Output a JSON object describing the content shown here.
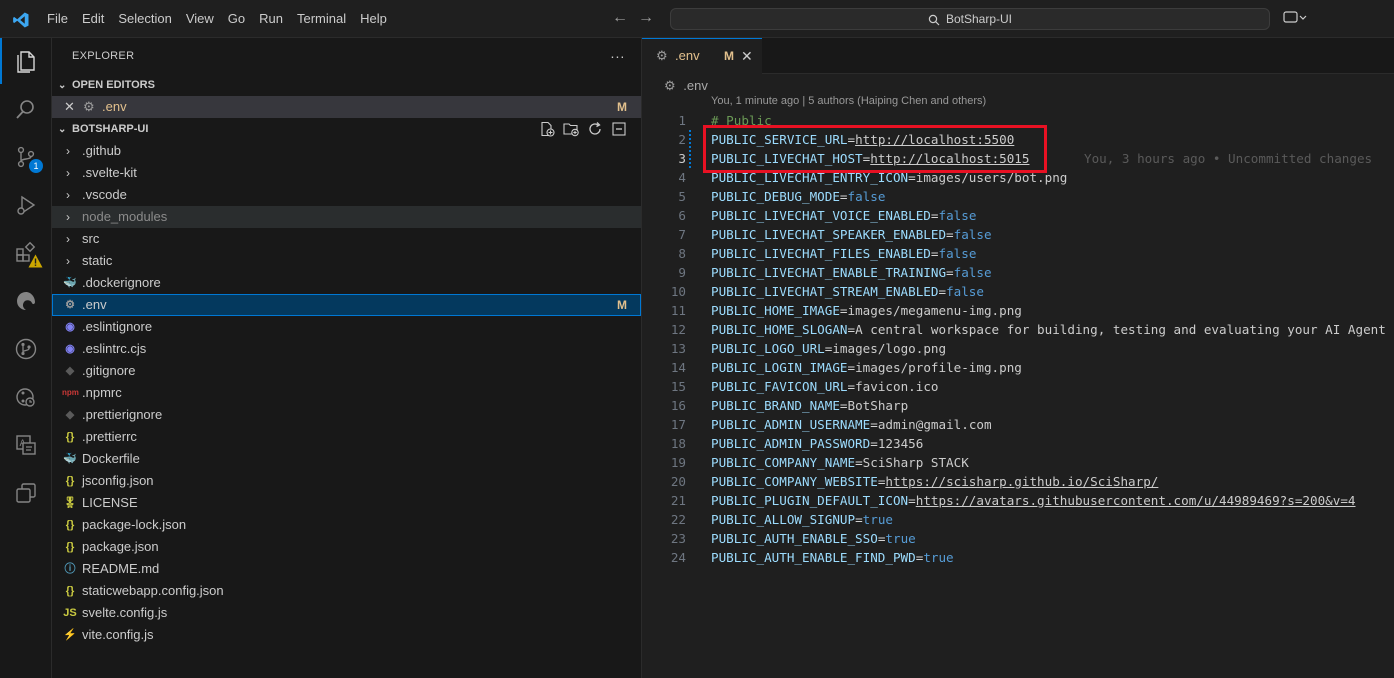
{
  "titlebar": {
    "menu": [
      "File",
      "Edit",
      "Selection",
      "View",
      "Go",
      "Run",
      "Terminal",
      "Help"
    ],
    "search_text": "BotSharp-UI"
  },
  "activity_bar": {
    "source_control_badge": "1"
  },
  "explorer": {
    "title": "EXPLORER",
    "more": "···",
    "open_editors": {
      "label": "OPEN EDITORS",
      "items": [
        {
          "name": ".env",
          "status": "M"
        }
      ]
    },
    "project": {
      "label": "BOTSHARP-UI",
      "items": [
        {
          "name": ".github",
          "type": "folder"
        },
        {
          "name": ".svelte-kit",
          "type": "folder"
        },
        {
          "name": ".vscode",
          "type": "folder"
        },
        {
          "name": "node_modules",
          "type": "folder"
        },
        {
          "name": "src",
          "type": "folder"
        },
        {
          "name": "static",
          "type": "folder"
        },
        {
          "name": ".dockerignore",
          "type": "file",
          "icon": "docker-icon"
        },
        {
          "name": ".env",
          "type": "file",
          "icon": "gear-icon",
          "status": "M"
        },
        {
          "name": ".eslintignore",
          "type": "file",
          "icon": "eslint-icon"
        },
        {
          "name": ".eslintrc.cjs",
          "type": "file",
          "icon": "eslint-icon"
        },
        {
          "name": ".gitignore",
          "type": "file",
          "icon": "git-icon"
        },
        {
          "name": ".npmrc",
          "type": "file",
          "icon": "npm-icon"
        },
        {
          "name": ".prettierignore",
          "type": "file",
          "icon": "prettier-icon"
        },
        {
          "name": ".prettierrc",
          "type": "file",
          "icon": "json-icon"
        },
        {
          "name": "Dockerfile",
          "type": "file",
          "icon": "docker-icon"
        },
        {
          "name": "jsconfig.json",
          "type": "file",
          "icon": "json-icon"
        },
        {
          "name": "LICENSE",
          "type": "file",
          "icon": "license-icon"
        },
        {
          "name": "package-lock.json",
          "type": "file",
          "icon": "json-icon"
        },
        {
          "name": "package.json",
          "type": "file",
          "icon": "json-icon"
        },
        {
          "name": "README.md",
          "type": "file",
          "icon": "info-icon"
        },
        {
          "name": "staticwebapp.config.json",
          "type": "file",
          "icon": "json-icon"
        },
        {
          "name": "svelte.config.js",
          "type": "file",
          "icon": "js-icon"
        },
        {
          "name": "vite.config.js",
          "type": "file",
          "icon": "vite-icon"
        }
      ]
    }
  },
  "editor": {
    "tab": {
      "name": ".env",
      "status": "M",
      "close": "✕"
    },
    "breadcrumb": ".env",
    "codelens": "You, 1 minute ago | 5 authors (Haiping Chen and others)",
    "blame": "You, 3 hours ago • Uncommitted changes",
    "lines": [
      {
        "n": "1",
        "comment": "# Public"
      },
      {
        "n": "2",
        "key": "PUBLIC_SERVICE_URL",
        "value": "http://localhost:5500",
        "kind": "url"
      },
      {
        "n": "3",
        "key": "PUBLIC_LIVECHAT_HOST",
        "value": "http://localhost:5015",
        "kind": "url"
      },
      {
        "n": "4",
        "key": "PUBLIC_LIVECHAT_ENTRY_ICON",
        "value": "images/users/bot.png",
        "kind": "str"
      },
      {
        "n": "5",
        "key": "PUBLIC_DEBUG_MODE",
        "value": "false",
        "kind": "bool"
      },
      {
        "n": "6",
        "key": "PUBLIC_LIVECHAT_VOICE_ENABLED",
        "value": "false",
        "kind": "bool"
      },
      {
        "n": "7",
        "key": "PUBLIC_LIVECHAT_SPEAKER_ENABLED",
        "value": "false",
        "kind": "bool"
      },
      {
        "n": "8",
        "key": "PUBLIC_LIVECHAT_FILES_ENABLED",
        "value": "false",
        "kind": "bool"
      },
      {
        "n": "9",
        "key": "PUBLIC_LIVECHAT_ENABLE_TRAINING",
        "value": "false",
        "kind": "bool"
      },
      {
        "n": "10",
        "key": "PUBLIC_LIVECHAT_STREAM_ENABLED",
        "value": "false",
        "kind": "bool"
      },
      {
        "n": "11",
        "key": "PUBLIC_HOME_IMAGE",
        "value": "images/megamenu-img.png",
        "kind": "str"
      },
      {
        "n": "12",
        "key": "PUBLIC_HOME_SLOGAN",
        "value": "A central workspace for building, testing and evaluating your AI Agent",
        "kind": "str"
      },
      {
        "n": "13",
        "key": "PUBLIC_LOGO_URL",
        "value": "images/logo.png",
        "kind": "str"
      },
      {
        "n": "14",
        "key": "PUBLIC_LOGIN_IMAGE",
        "value": "images/profile-img.png",
        "kind": "str"
      },
      {
        "n": "15",
        "key": "PUBLIC_FAVICON_URL",
        "value": "favicon.ico",
        "kind": "str"
      },
      {
        "n": "16",
        "key": "PUBLIC_BRAND_NAME",
        "value": "BotSharp",
        "kind": "str"
      },
      {
        "n": "17",
        "key": "PUBLIC_ADMIN_USERNAME",
        "value": "admin@gmail.com",
        "kind": "str"
      },
      {
        "n": "18",
        "key": "PUBLIC_ADMIN_PASSWORD",
        "value": "123456",
        "kind": "str"
      },
      {
        "n": "19",
        "key": "PUBLIC_COMPANY_NAME",
        "value": "SciSharp STACK",
        "kind": "str"
      },
      {
        "n": "20",
        "key": "PUBLIC_COMPANY_WEBSITE",
        "value": "https://scisharp.github.io/SciSharp/",
        "kind": "url"
      },
      {
        "n": "21",
        "key": "PUBLIC_PLUGIN_DEFAULT_ICON",
        "value": "https://avatars.githubusercontent.com/u/44989469?s=200&v=4",
        "kind": "url"
      },
      {
        "n": "22",
        "key": "PUBLIC_ALLOW_SIGNUP",
        "value": "true",
        "kind": "bool"
      },
      {
        "n": "23",
        "key": "PUBLIC_AUTH_ENABLE_SSO",
        "value": "true",
        "kind": "bool"
      },
      {
        "n": "24",
        "key": "PUBLIC_AUTH_ENABLE_FIND_PWD",
        "value": "true",
        "kind": "bool"
      }
    ]
  },
  "colors": {
    "accent": "#0078d4",
    "modified": "#e2c08d",
    "highlight_box": "#e81123"
  }
}
